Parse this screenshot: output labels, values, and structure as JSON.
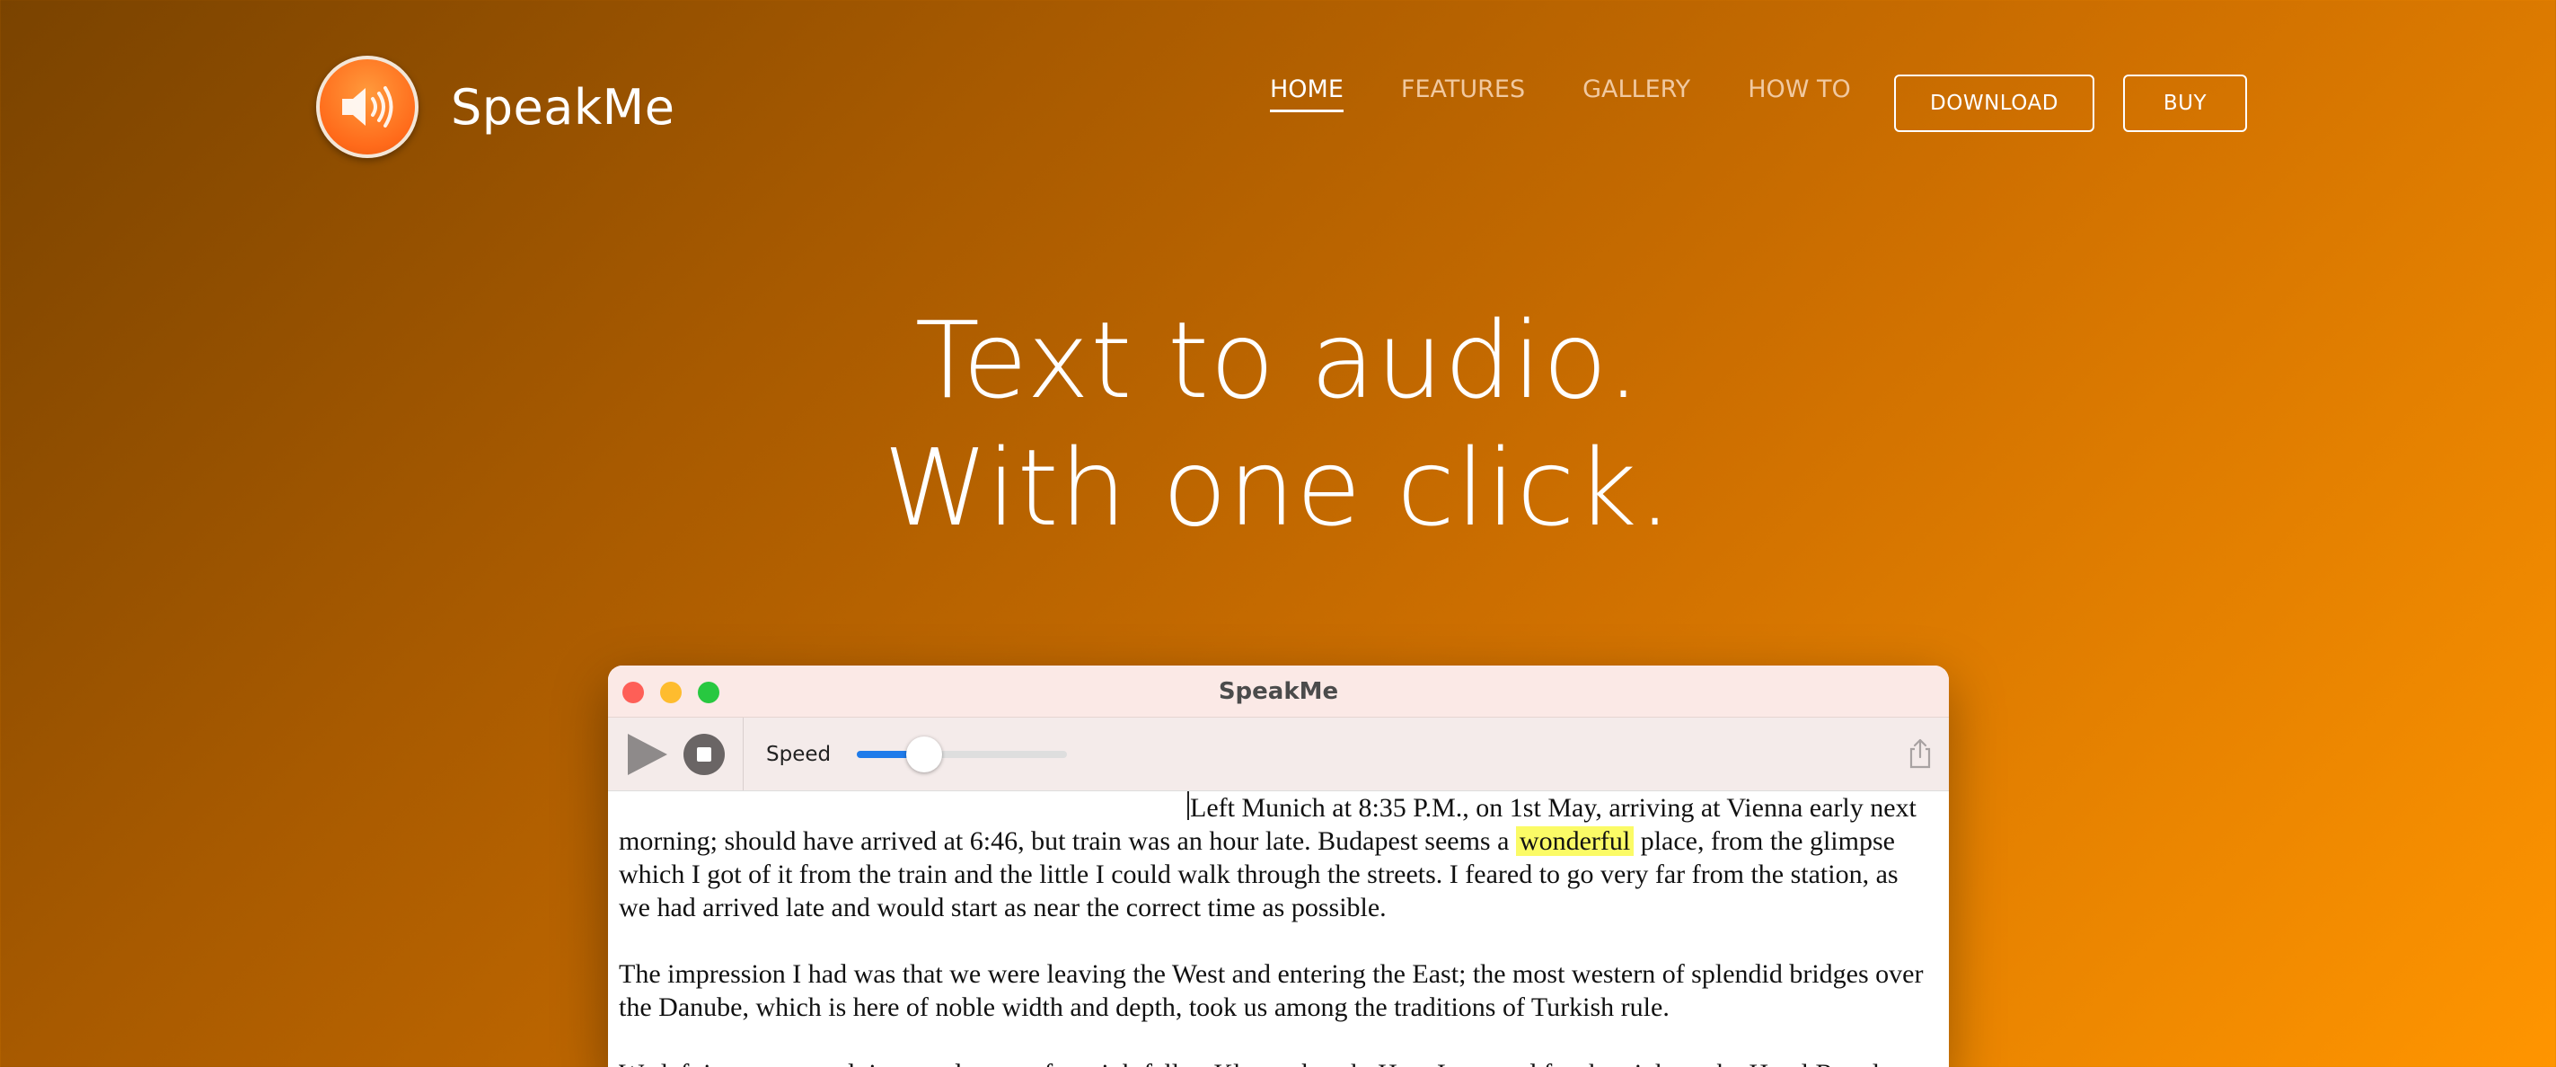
{
  "header": {
    "brand": "SpeakMe",
    "nav": [
      "HOME",
      "FEATURES",
      "GALLERY",
      "HOW TO"
    ],
    "active_nav": "HOME",
    "buttons": {
      "download": "DOWNLOAD",
      "buy": "BUY"
    }
  },
  "hero": {
    "line1": "Text to audio.",
    "line2": "With one click."
  },
  "app_window": {
    "title": "SpeakMe",
    "toolbar": {
      "speed_label": "Speed",
      "speed_value": 0.32
    },
    "paragraphs": [
      {
        "before": "Left Munich at 8:35 P.M., on 1st May, arriving at Vienna early next morning; should have arrived at 6:46, but train was an hour late. Budapest seems a ",
        "highlight": "wonderful",
        "after": " place, from the glimpse which I got of it from the train and the little I could walk through the streets. I feared to go very far from the station, as we had arrived late and would start as near the correct time as possible."
      },
      {
        "text": "The impression I had was that we were leaving the West and entering the East; the most western of splendid bridges over the Danube, which is here of noble width and depth, took us among the traditions of Turkish rule."
      },
      {
        "text": "We left in pretty good time, and came after nightfall to Klausenburgh. Here I stopped for the night at the Hotel Royale."
      }
    ]
  },
  "colors": {
    "accent": "#1f7bea",
    "highlight": "#fbfb66",
    "logo": "#ff6a1a"
  }
}
